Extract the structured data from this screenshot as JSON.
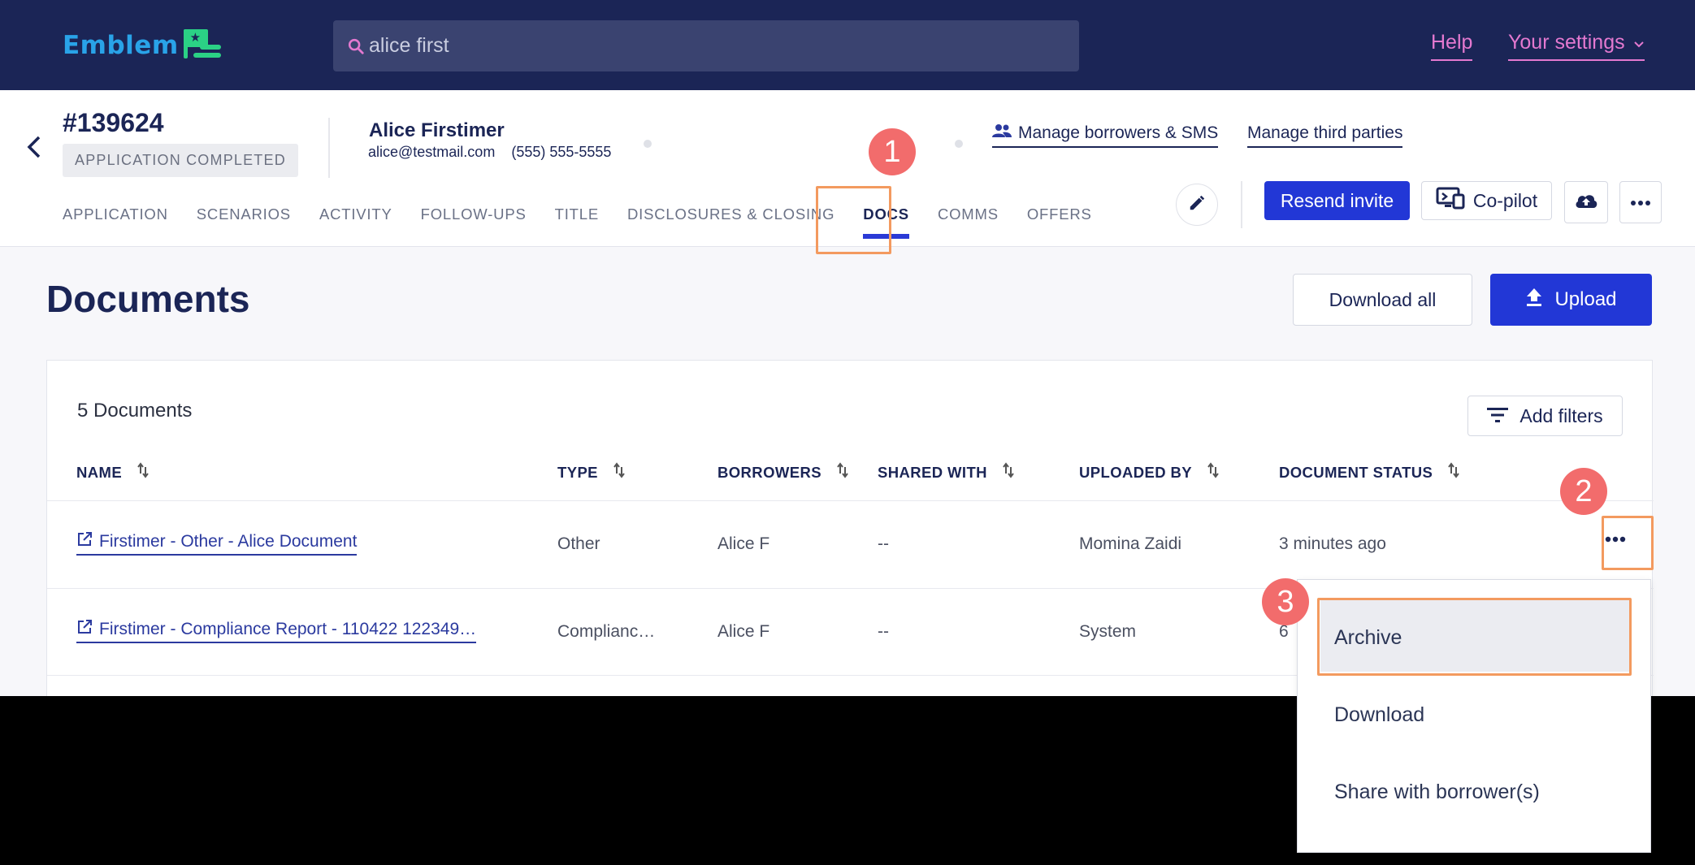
{
  "topbar": {
    "logo_text": "Emblem",
    "search_value": "alice first",
    "help_label": "Help",
    "settings_label": "Your settings"
  },
  "header": {
    "app_number": "#139624",
    "app_status": "APPLICATION COMPLETED",
    "borrower_name": "Alice Firstimer",
    "borrower_email": "alice@testmail.com",
    "borrower_phone": "(555) 555-5555",
    "manage_borrowers": "Manage borrowers & SMS",
    "manage_third_parties": "Manage third parties",
    "resend_invite": "Resend invite",
    "copilot": "Co-pilot",
    "tabs": [
      {
        "label": "APPLICATION"
      },
      {
        "label": "SCENARIOS"
      },
      {
        "label": "ACTIVITY"
      },
      {
        "label": "FOLLOW-UPS"
      },
      {
        "label": "TITLE"
      },
      {
        "label": "DISCLOSURES & CLOSING"
      },
      {
        "label": "DOCS"
      },
      {
        "label": "COMMS"
      },
      {
        "label": "OFFERS"
      }
    ]
  },
  "documents": {
    "title": "Documents",
    "download_all": "Download all",
    "upload": "Upload",
    "count_label": "5 Documents",
    "add_filters": "Add filters",
    "columns": [
      "NAME",
      "TYPE",
      "BORROWERS",
      "SHARED WITH",
      "UPLOADED BY",
      "DOCUMENT STATUS"
    ],
    "rows": [
      {
        "name": "Firstimer - Other - Alice Document",
        "type": "Other",
        "borrowers": "Alice F",
        "shared_with": "--",
        "uploaded_by": "Momina Zaidi",
        "status": "3 minutes ago"
      },
      {
        "name": "Firstimer - Compliance Report - 110422 122349…",
        "type": "Complianc…",
        "borrowers": "Alice F",
        "shared_with": "--",
        "uploaded_by": "System",
        "status": "6"
      }
    ]
  },
  "menu": {
    "items": [
      "Archive",
      "Download",
      "Share with borrower(s)"
    ]
  },
  "annotations": [
    "1",
    "2",
    "3"
  ],
  "colors": {
    "navy": "#1b2556",
    "primary": "#2237d6",
    "highlight": "#f39a5f",
    "badge": "#f26c6c",
    "link_pink": "#e479d0"
  }
}
